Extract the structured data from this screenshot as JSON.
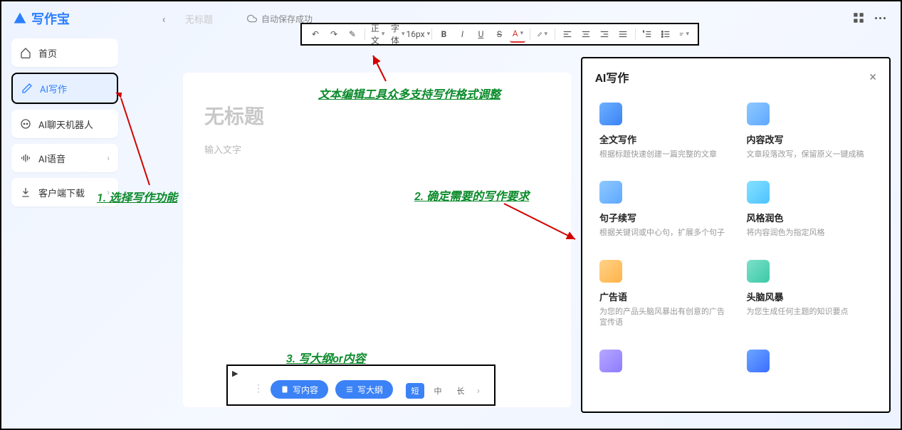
{
  "app": {
    "name": "写作宝"
  },
  "topnav": {
    "ghost_label": "无标题",
    "autosave_label": "自动保存成功"
  },
  "sidebar": {
    "items": [
      {
        "label": "首页",
        "active": false
      },
      {
        "label": "AI写作",
        "active": true
      },
      {
        "label": "AI聊天机器人",
        "active": false
      },
      {
        "label": "AI语音",
        "active": false,
        "chevron": true
      },
      {
        "label": "客户端下载",
        "active": false,
        "chevron": true
      }
    ]
  },
  "toolbar": {
    "undo": "↶",
    "redo": "↷",
    "clear": "✎",
    "para": "正文",
    "font": "字体",
    "size": "16px",
    "bold": "B",
    "italic": "I",
    "underline": "U",
    "strike": "S",
    "color": "A",
    "highlight": "✎"
  },
  "editor": {
    "title_placeholder": "无标题",
    "body_placeholder": "输入文字"
  },
  "ai_panel": {
    "title": "AI写作",
    "cards": [
      {
        "title": "全文写作",
        "desc": "根据标题快速创建一篇完整的文章"
      },
      {
        "title": "内容改写",
        "desc": "文章段落改写，保留原义一键成稿"
      },
      {
        "title": "句子续写",
        "desc": "根据关键词或中心句，扩展多个句子"
      },
      {
        "title": "风格润色",
        "desc": "将内容润色为指定风格"
      },
      {
        "title": "广告语",
        "desc": "为您的产品头脑风暴出有创意的广告宣传语"
      },
      {
        "title": "头脑风暴",
        "desc": "为您生成任何主题的知识要点"
      }
    ],
    "extra_visible": 2
  },
  "bottom_bar": {
    "write_content": "写内容",
    "write_outline": "写大纲",
    "len_short": "短",
    "len_mid": "中",
    "len_long": "长"
  },
  "annotations": {
    "a1": "1. 选择写作功能",
    "a2": "2. 确定需要的写作要求",
    "a3": "3. 写大纲or内容",
    "a_toolbar": "文本编辑工具众多支持写作格式调整"
  }
}
